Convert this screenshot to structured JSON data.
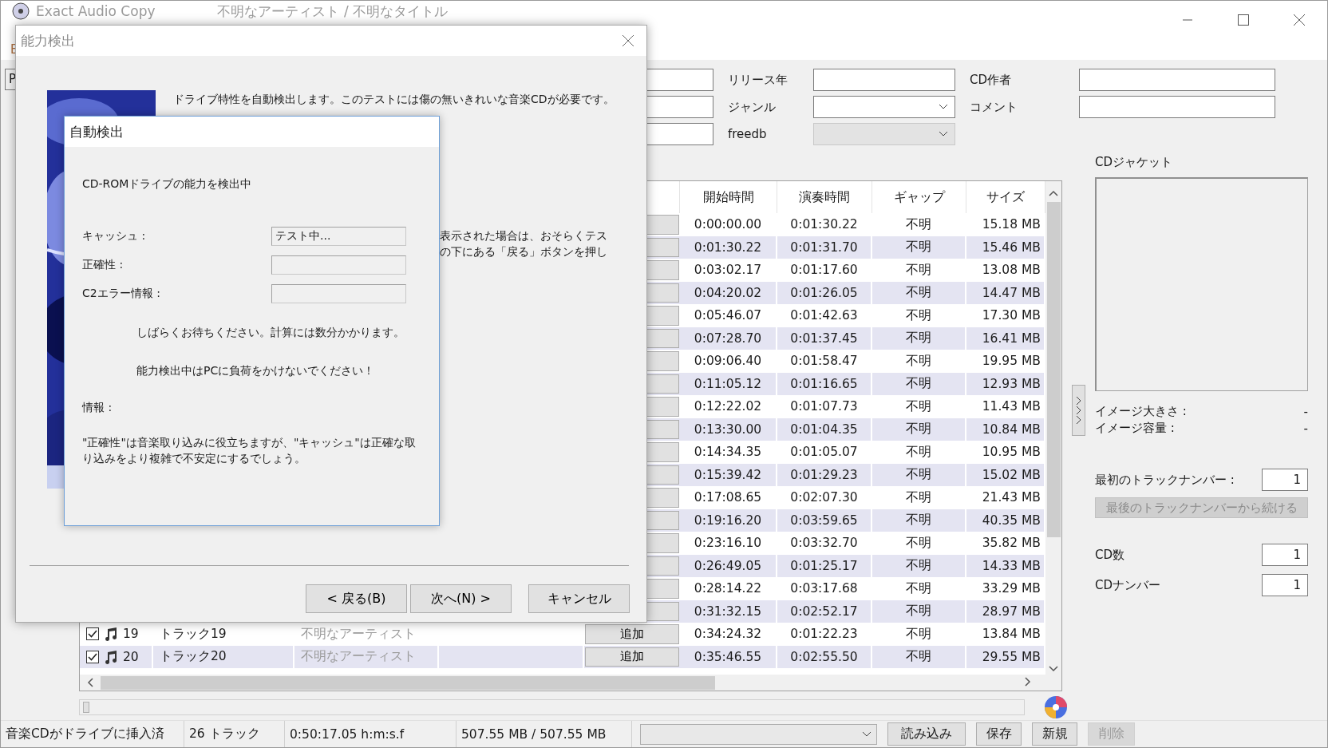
{
  "window": {
    "app_title": "Exact Audio Copy",
    "album_title": "不明なアーティスト / 不明なタイトル"
  },
  "menu": [
    "E"
  ],
  "drive_field": {
    "value": "P"
  },
  "fields_left": [
    {
      "label": "リリース年",
      "kind": "text"
    },
    {
      "label": "ジャンル",
      "kind": "combo",
      "disabled": false
    },
    {
      "label": "freedb",
      "kind": "combo",
      "disabled": true
    }
  ],
  "fields_right": [
    {
      "label": "CD作者"
    },
    {
      "label": "コメント"
    }
  ],
  "table": {
    "columns": [
      "開始時間",
      "演奏時間",
      "ギャップ",
      "サイズ"
    ],
    "rows": [
      {
        "start": "0:00:00.00",
        "length": "0:01:30.22",
        "gap": "不明",
        "size": "15.18 MB"
      },
      {
        "start": "0:01:30.22",
        "length": "0:01:31.70",
        "gap": "不明",
        "size": "15.46 MB"
      },
      {
        "start": "0:03:02.17",
        "length": "0:01:17.60",
        "gap": "不明",
        "size": "13.08 MB"
      },
      {
        "start": "0:04:20.02",
        "length": "0:01:26.05",
        "gap": "不明",
        "size": "14.47 MB"
      },
      {
        "start": "0:05:46.07",
        "length": "0:01:42.63",
        "gap": "不明",
        "size": "17.30 MB"
      },
      {
        "start": "0:07:28.70",
        "length": "0:01:37.45",
        "gap": "不明",
        "size": "16.41 MB"
      },
      {
        "start": "0:09:06.40",
        "length": "0:01:58.47",
        "gap": "不明",
        "size": "19.95 MB"
      },
      {
        "start": "0:11:05.12",
        "length": "0:01:16.65",
        "gap": "不明",
        "size": "12.93 MB"
      },
      {
        "start": "0:12:22.02",
        "length": "0:01:07.73",
        "gap": "不明",
        "size": "11.43 MB"
      },
      {
        "start": "0:13:30.00",
        "length": "0:01:04.35",
        "gap": "不明",
        "size": "10.84 MB"
      },
      {
        "start": "0:14:34.35",
        "length": "0:01:05.07",
        "gap": "不明",
        "size": "10.95 MB"
      },
      {
        "start": "0:15:39.42",
        "length": "0:01:29.23",
        "gap": "不明",
        "size": "15.02 MB"
      },
      {
        "start": "0:17:08.65",
        "length": "0:02:07.30",
        "gap": "不明",
        "size": "21.43 MB"
      },
      {
        "start": "0:19:16.20",
        "length": "0:03:59.65",
        "gap": "不明",
        "size": "40.35 MB"
      },
      {
        "start": "0:23:16.10",
        "length": "0:03:32.70",
        "gap": "不明",
        "size": "35.82 MB"
      },
      {
        "start": "0:26:49.05",
        "length": "0:01:25.17",
        "gap": "不明",
        "size": "14.33 MB"
      },
      {
        "start": "0:28:14.22",
        "length": "0:03:17.68",
        "gap": "不明",
        "size": "33.29 MB"
      },
      {
        "start": "0:31:32.15",
        "length": "0:02:52.17",
        "gap": "不明",
        "size": "28.97 MB"
      },
      {
        "checked": true,
        "number": "19",
        "title": "トラック19",
        "artist": "不明なアーティスト",
        "button": "追加",
        "start": "0:34:24.32",
        "length": "0:01:22.23",
        "gap": "不明",
        "size": "13.84 MB"
      },
      {
        "checked": true,
        "number": "20",
        "title": "トラック20",
        "artist": "不明なアーティスト",
        "button": "追加",
        "start": "0:35:46.55",
        "length": "0:02:55.50",
        "gap": "不明",
        "size": "29.55 MB"
      }
    ]
  },
  "position_slider": {
    "level": 0
  },
  "right_panel": {
    "jacket_label": "CDジャケット",
    "image_info": [
      {
        "label": "イメージ大きさ :",
        "value": "-"
      },
      {
        "label": "イメージ容量 :",
        "value": "-"
      }
    ],
    "first_track": {
      "label": "最初のトラックナンバー :",
      "value": "1"
    },
    "continue_button": {
      "label": "最後のトラックナンバーから続ける",
      "disabled": true
    },
    "cd_fields": [
      {
        "label": "CD数",
        "value": "1"
      },
      {
        "label": "CDナンバー",
        "value": "1"
      }
    ]
  },
  "status_bar": {
    "segments": [
      "音楽CDがドライブに挿入済",
      "26 トラック",
      "0:50:17.05 h:m:s.f",
      "507.55 MB / 507.55 MB"
    ],
    "buttons": [
      {
        "label": "読み込み",
        "disabled": false
      },
      {
        "label": "保存",
        "disabled": false
      },
      {
        "label": "新規",
        "disabled": false
      },
      {
        "label": "削除",
        "disabled": true
      }
    ]
  },
  "dialog": {
    "title": "能力検出",
    "intro": "ドライブ特性を自動検出します。このテストには傷の無いきれいな音楽CDが必要です。",
    "partial_lines": [
      "表示された場合は、おそらくテス",
      "の下にある「戻る」ボタンを押し"
    ],
    "buttons": [
      "< 戻る(B)",
      "次へ(N) >",
      "キャンセル"
    ]
  },
  "inner_dialog": {
    "title": "自動検出",
    "status": "CD-ROMドライブの能力を検出中",
    "rows": [
      {
        "label": "キャッシュ :",
        "value": "テスト中..."
      },
      {
        "label": "正確性 :"
      },
      {
        "label": "C2エラー情報 :"
      }
    ],
    "notes": [
      "しばらくお待ちください。計算には数分かかります。",
      "能力検出中はPCに負荷をかけないでください！"
    ],
    "info_label": "情報 :",
    "info_text": "\"正確性\"は音楽取り込みに役立ちますが、\"キャッシュ\"は正確な取り込みをより複雑で不安定にするでしょう。"
  }
}
